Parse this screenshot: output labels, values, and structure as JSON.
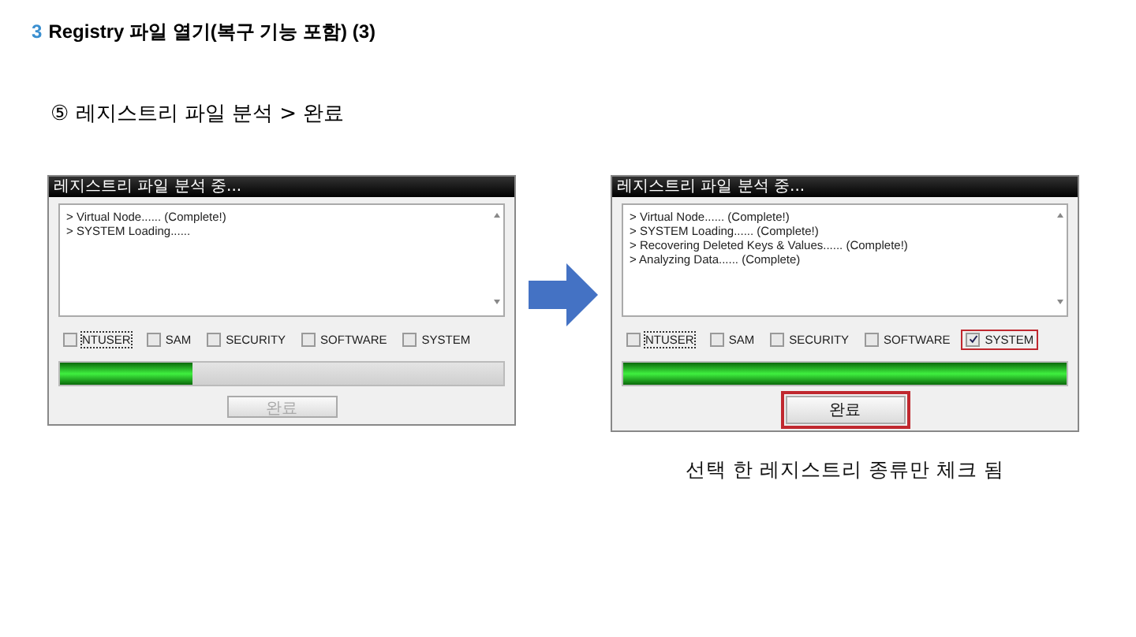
{
  "slide": {
    "number": "3",
    "title": "Registry 파일 열기(복구 기능 포함) (3)",
    "step": "⑤ 레지스트리 파일 분석 > 완료"
  },
  "dialogs": [
    {
      "title": "레지스트리 파일 분석 중...",
      "log": [
        "> Virtual Node...... (Complete!)",
        "> SYSTEM  Loading......"
      ],
      "options": [
        {
          "label": "NTUSER",
          "checked": false,
          "focused": true,
          "highlighted": false
        },
        {
          "label": "SAM",
          "checked": false,
          "focused": false,
          "highlighted": false
        },
        {
          "label": "SECURITY",
          "checked": false,
          "focused": false,
          "highlighted": false
        },
        {
          "label": "SOFTWARE",
          "checked": false,
          "focused": false,
          "highlighted": false
        },
        {
          "label": "SYSTEM",
          "checked": false,
          "focused": false,
          "highlighted": false
        }
      ],
      "progress": {
        "level": 0.3
      },
      "button": {
        "label": "완료",
        "disabled": true,
        "highlighted": false
      }
    },
    {
      "title": "레지스트리 파일 분석 중...",
      "log": [
        "> Virtual Node...... (Complete!)",
        "> SYSTEM  Loading...... (Complete!)",
        "> Recovering Deleted Keys & Values...... (Complete!)",
        "> Analyzing Data...... (Complete)"
      ],
      "options": [
        {
          "label": "NTUSER",
          "checked": false,
          "focused": true,
          "highlighted": false
        },
        {
          "label": "SAM",
          "checked": false,
          "focused": false,
          "highlighted": false
        },
        {
          "label": "SECURITY",
          "checked": false,
          "focused": false,
          "highlighted": false
        },
        {
          "label": "SOFTWARE",
          "checked": false,
          "focused": false,
          "highlighted": false
        },
        {
          "label": "SYSTEM",
          "checked": true,
          "focused": false,
          "highlighted": true
        }
      ],
      "progress": {
        "level": 1
      },
      "button": {
        "label": "완료",
        "disabled": false,
        "highlighted": true
      }
    }
  ],
  "caption": "선택 한 레지스트리 종류만 체크 됨"
}
